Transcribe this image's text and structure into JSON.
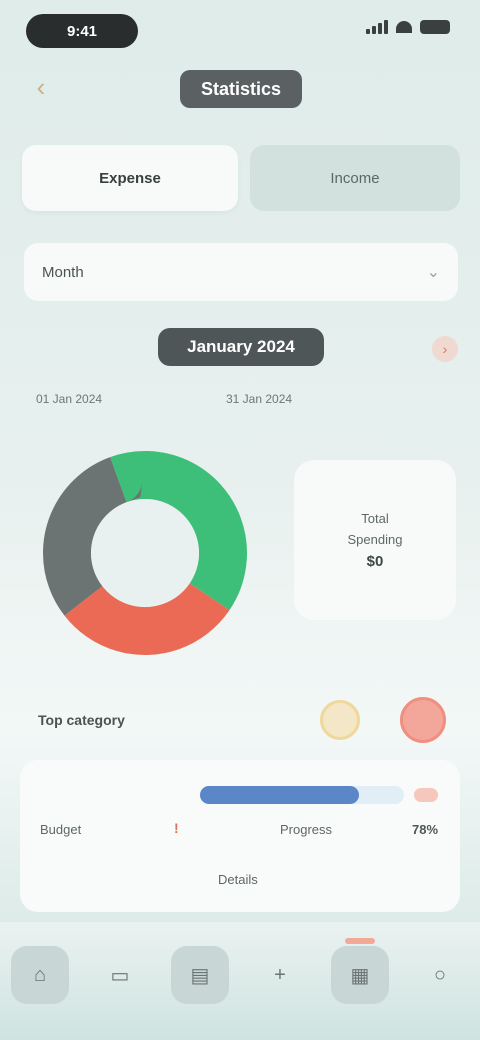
{
  "status_bar": {
    "time": "9:41"
  },
  "header": {
    "back_icon": "back-arrow-icon",
    "title": "Statistics"
  },
  "tabs": [
    {
      "label": "Expense"
    },
    {
      "label": "Income"
    }
  ],
  "selector": {
    "label": "Month",
    "chevron_icon": "chevron-down-icon"
  },
  "date_nav": {
    "title": "January 2024",
    "next_icon": "chevron-right-icon"
  },
  "range": {
    "left": "01 Jan 2024",
    "right": "31 Jan 2024"
  },
  "donut": {
    "segments": [
      {
        "label": "Green",
        "percent": 40,
        "color": "#3dbf7a"
      },
      {
        "label": "Red",
        "percent": 30,
        "color": "#ea6a55"
      },
      {
        "label": "Gray",
        "percent": 30,
        "color": "#6b7473"
      }
    ]
  },
  "legend_card": {
    "line1": "Total",
    "line2": "Spending",
    "value": "$0"
  },
  "summary": {
    "label": "Top category",
    "red_badge_text": ""
  },
  "stats": {
    "progress_fraction": 0.78,
    "left_label": "Budget",
    "flag": "!",
    "mid_label": "Progress",
    "right_value": "78%",
    "footer": "Details"
  },
  "bottom_nav": [
    {
      "icon": "home-icon",
      "filled": true
    },
    {
      "icon": "wallet-icon",
      "filled": false
    },
    {
      "icon": "chart-icon",
      "filled": true
    },
    {
      "icon": "plus-icon",
      "filled": false
    },
    {
      "icon": "calendar-icon",
      "filled": true,
      "active": true
    },
    {
      "icon": "profile-icon",
      "filled": false
    }
  ]
}
